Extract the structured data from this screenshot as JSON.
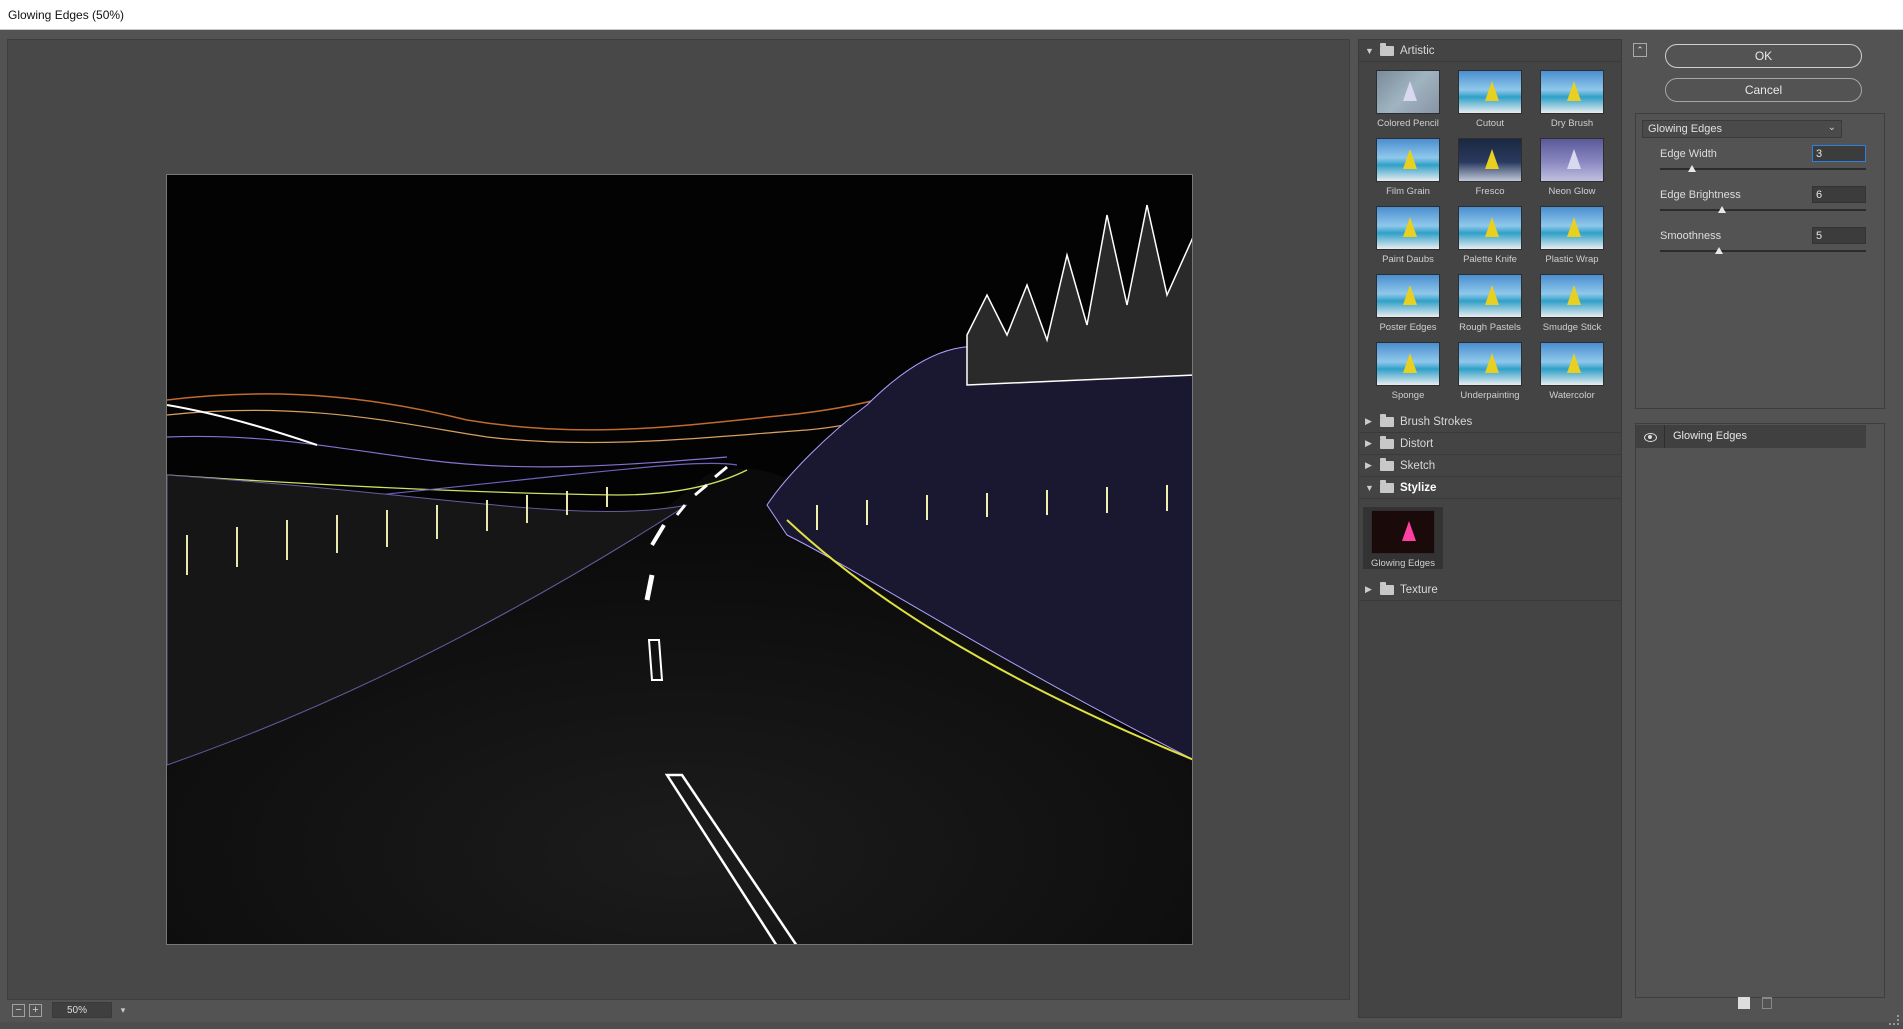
{
  "window": {
    "title": "Glowing Edges (50%)"
  },
  "preview": {
    "zoom": "50%",
    "zoom_out_label": "−",
    "zoom_in_label": "+",
    "zoom_menu_icon": "chevron-down-icon"
  },
  "gallery": {
    "categories": [
      {
        "name": "Artistic",
        "expanded": true,
        "filters": [
          "Colored Pencil",
          "Cutout",
          "Dry Brush",
          "Film Grain",
          "Fresco",
          "Neon Glow",
          "Paint Daubs",
          "Palette Knife",
          "Plastic Wrap",
          "Poster Edges",
          "Rough Pastels",
          "Smudge Stick",
          "Sponge",
          "Underpainting",
          "Watercolor"
        ]
      },
      {
        "name": "Brush Strokes",
        "expanded": false
      },
      {
        "name": "Distort",
        "expanded": false
      },
      {
        "name": "Sketch",
        "expanded": false
      },
      {
        "name": "Stylize",
        "expanded": true,
        "filters": [
          "Glowing Edges"
        ]
      },
      {
        "name": "Texture",
        "expanded": false
      }
    ],
    "selected_filter": "Glowing Edges"
  },
  "buttons": {
    "ok": "OK",
    "cancel": "Cancel"
  },
  "settings": {
    "filter_select": "Glowing Edges",
    "params": [
      {
        "label": "Edge Width",
        "value": "3",
        "min": 1,
        "max": 14
      },
      {
        "label": "Edge Brightness",
        "value": "6",
        "min": 0,
        "max": 20
      },
      {
        "label": "Smoothness",
        "value": "5",
        "min": 1,
        "max": 15
      }
    ]
  },
  "layers": [
    {
      "name": "Glowing Edges",
      "visible": true
    }
  ],
  "colors": {
    "panel": "#535353",
    "field_focus": "#2d7fe0",
    "image_bg": "#050505"
  }
}
